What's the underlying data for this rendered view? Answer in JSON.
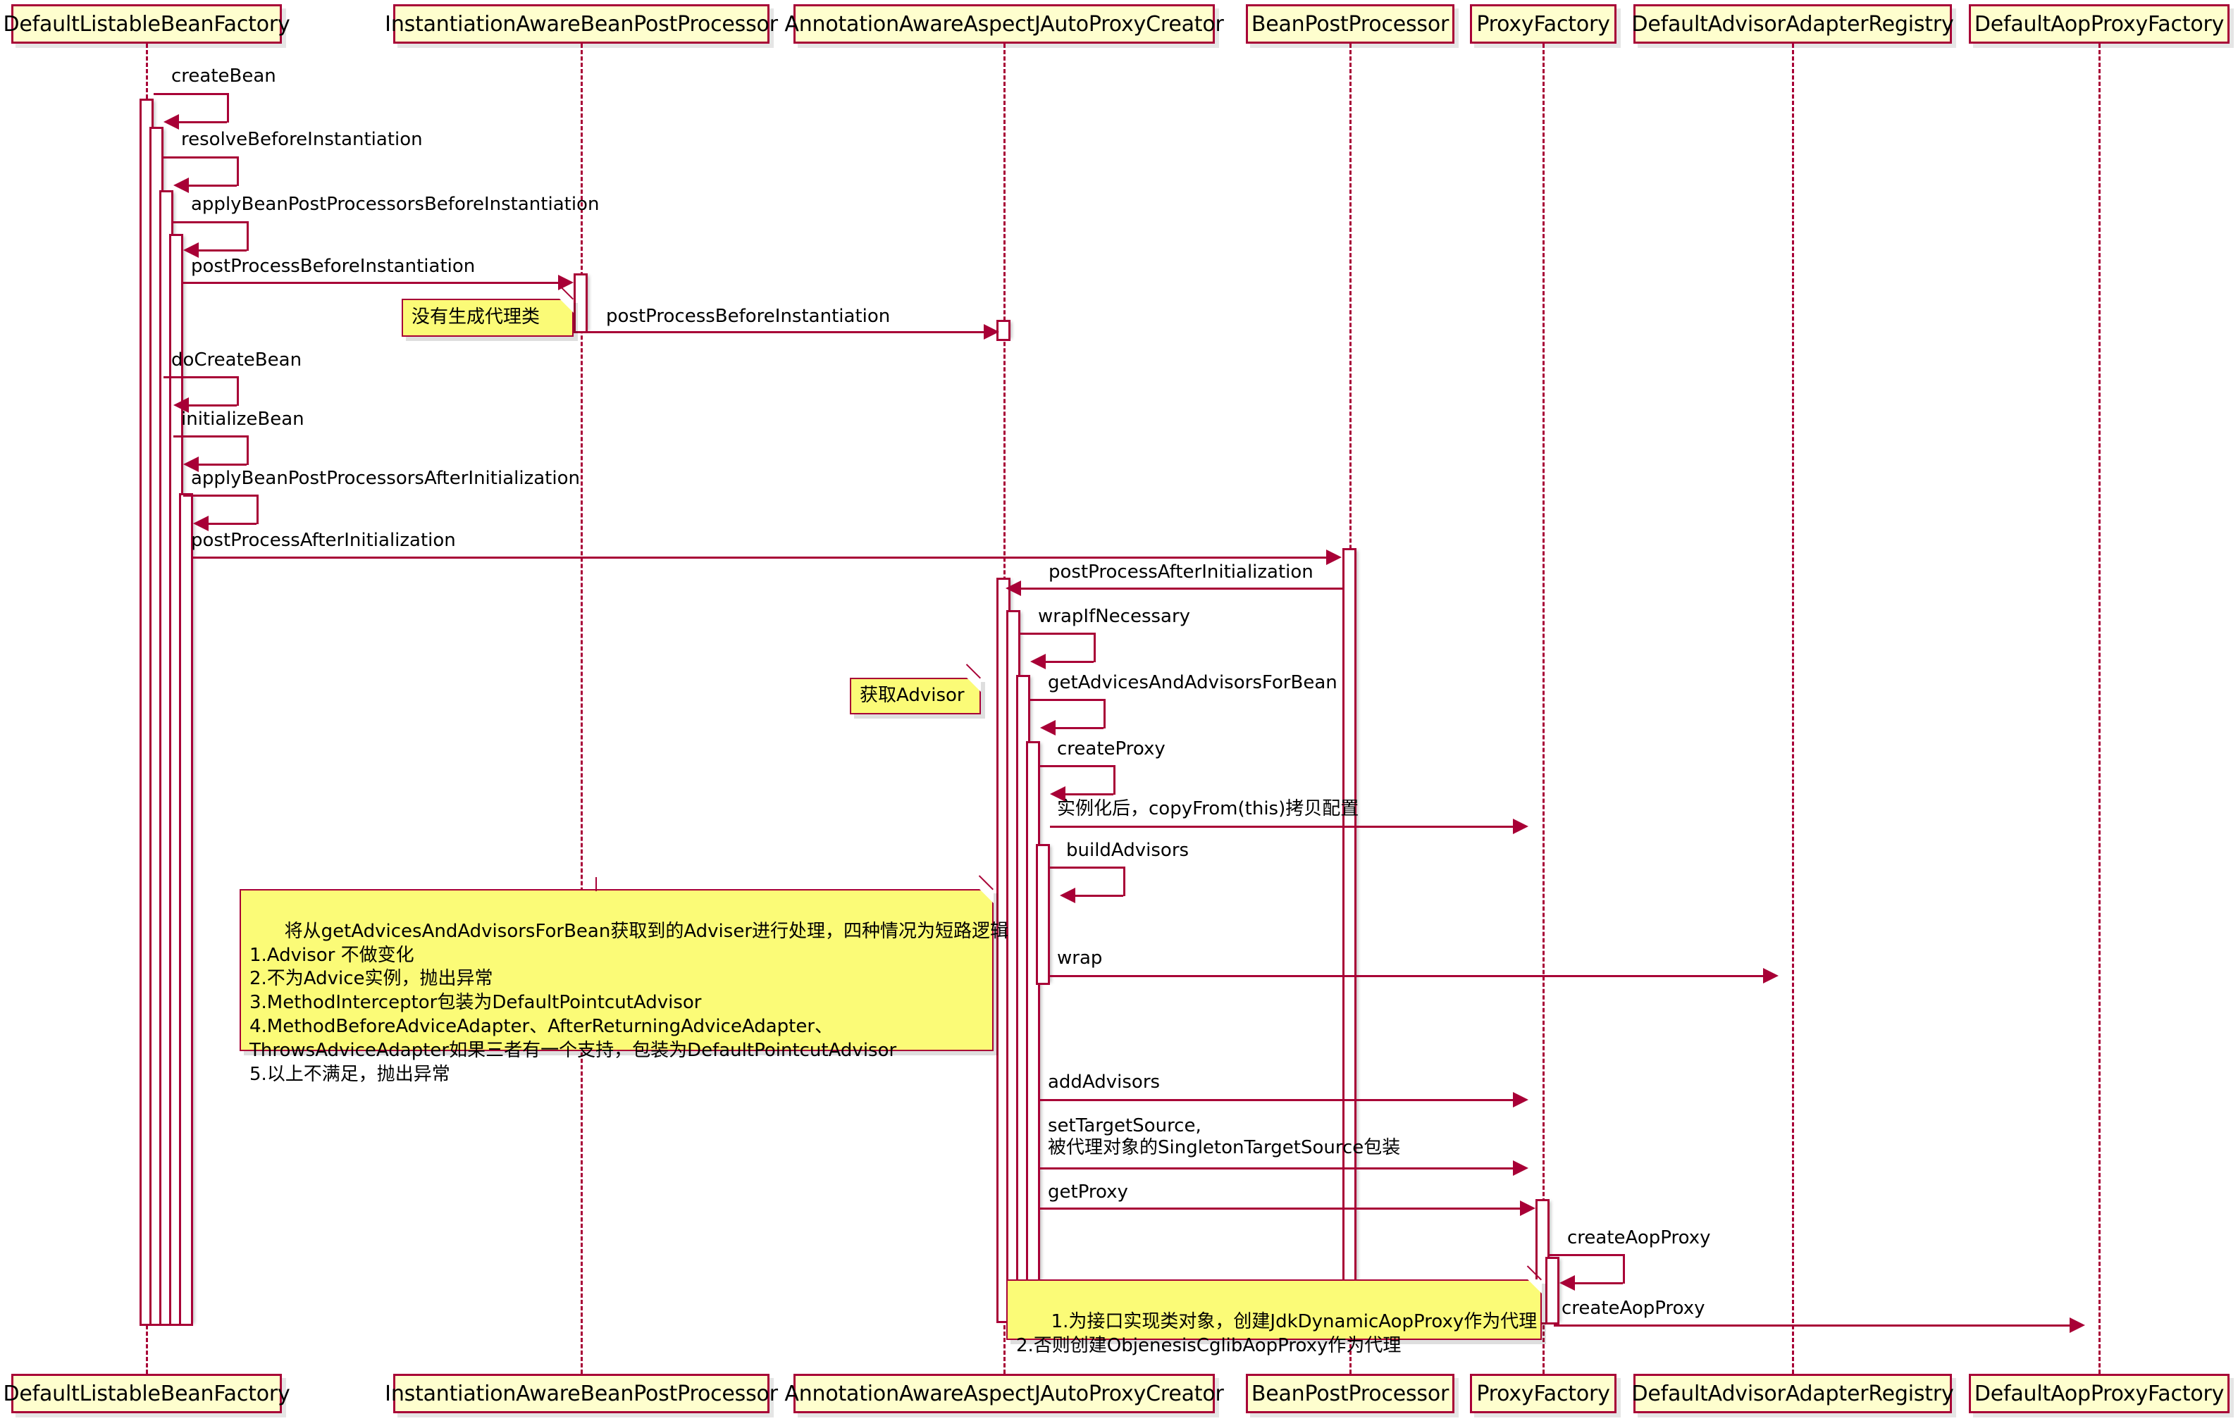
{
  "diagram": {
    "title": "Spring AOP bean creation sequence diagram",
    "type": "uml-sequence-diagram",
    "colors": {
      "box_fill": "#FEFECE",
      "border": "#A80036",
      "note_fill": "#FBFB77",
      "activation_fill": "#FFFFFF",
      "text": "#000000",
      "background": "#FFFFFF"
    }
  },
  "participants": [
    {
      "id": "dlbf",
      "label": "DefaultListableBeanFactory"
    },
    {
      "id": "iabpp",
      "label": "InstantiationAwareBeanPostProcessor"
    },
    {
      "id": "aaajapc",
      "label": "AnnotationAwareAspectJAutoProxyCreator"
    },
    {
      "id": "bpp",
      "label": "BeanPostProcessor"
    },
    {
      "id": "pf",
      "label": "ProxyFactory"
    },
    {
      "id": "daar",
      "label": "DefaultAdvisorAdapterRegistry"
    },
    {
      "id": "dapf",
      "label": "DefaultAopProxyFactory"
    }
  ],
  "messages": [
    {
      "n": 1,
      "label": "createBean",
      "from": "dlbf",
      "to": "dlbf",
      "kind": "self"
    },
    {
      "n": 2,
      "label": "resolveBeforeInstantiation",
      "from": "dlbf",
      "to": "dlbf",
      "kind": "self"
    },
    {
      "n": 3,
      "label": "applyBeanPostProcessorsBeforeInstantiation",
      "from": "dlbf",
      "to": "dlbf",
      "kind": "self"
    },
    {
      "n": 4,
      "label": "postProcessBeforeInstantiation",
      "from": "dlbf",
      "to": "iabpp",
      "kind": "call"
    },
    {
      "n": 5,
      "label": "postProcessBeforeInstantiation",
      "from": "iabpp",
      "to": "aaajapc",
      "kind": "call"
    },
    {
      "n": 6,
      "label": "doCreateBean",
      "from": "dlbf",
      "to": "dlbf",
      "kind": "self"
    },
    {
      "n": 7,
      "label": "initializeBean",
      "from": "dlbf",
      "to": "dlbf",
      "kind": "self"
    },
    {
      "n": 8,
      "label": "applyBeanPostProcessorsAfterInitialization",
      "from": "dlbf",
      "to": "dlbf",
      "kind": "self"
    },
    {
      "n": 9,
      "label": "postProcessAfterInitialization",
      "from": "dlbf",
      "to": "bpp",
      "kind": "call"
    },
    {
      "n": 10,
      "label": "postProcessAfterInitialization",
      "from": "bpp",
      "to": "aaajapc",
      "kind": "return"
    },
    {
      "n": 11,
      "label": "wrapIfNecessary",
      "from": "aaajapc",
      "to": "aaajapc",
      "kind": "self"
    },
    {
      "n": 12,
      "label": "getAdvicesAndAdvisorsForBean",
      "from": "aaajapc",
      "to": "aaajapc",
      "kind": "self"
    },
    {
      "n": 13,
      "label": "createProxy",
      "from": "aaajapc",
      "to": "aaajapc",
      "kind": "self"
    },
    {
      "n": 14,
      "label": "实例化后，copyFrom(this)拷贝配置",
      "from": "aaajapc",
      "to": "pf",
      "kind": "call"
    },
    {
      "n": 15,
      "label": "buildAdvisors",
      "from": "aaajapc",
      "to": "aaajapc",
      "kind": "self"
    },
    {
      "n": 16,
      "label": "wrap",
      "from": "aaajapc",
      "to": "daar",
      "kind": "call"
    },
    {
      "n": 17,
      "label": "addAdvisors",
      "from": "aaajapc",
      "to": "pf",
      "kind": "call"
    },
    {
      "n": 18,
      "label": "setTargetSource,\n被代理对象的SingletonTargetSource包装",
      "from": "aaajapc",
      "to": "pf",
      "kind": "call"
    },
    {
      "n": 19,
      "label": "getProxy",
      "from": "aaajapc",
      "to": "pf",
      "kind": "call"
    },
    {
      "n": 20,
      "label": "createAopProxy",
      "from": "pf",
      "to": "pf",
      "kind": "self"
    },
    {
      "n": 21,
      "label": "createAopProxy",
      "from": "pf",
      "to": "dapf",
      "kind": "call"
    }
  ],
  "notes": [
    {
      "id": "note1",
      "text": "没有生成代理类"
    },
    {
      "id": "note2",
      "text": "获取Advisor"
    },
    {
      "id": "note3",
      "text": "将从getAdvicesAndAdvisorsForBean获取到的Adviser进行处理，四种情况为短路逻辑\n1.Advisor 不做变化\n2.不为Advice实例，抛出异常\n3.MethodInterceptor包装为DefaultPointcutAdvisor\n4.MethodBeforeAdviceAdapter、AfterReturningAdviceAdapter、\nThrowsAdviceAdapter如果三者有一个支持，包装为DefaultPointcutAdvisor\n5.以上不满足，抛出异常"
    },
    {
      "id": "note4",
      "text": "1.为接口实现类对象，创建JdkDynamicAopProxy作为代理\n2.否则创建ObjenesisCglibAopProxy作为代理"
    }
  ]
}
